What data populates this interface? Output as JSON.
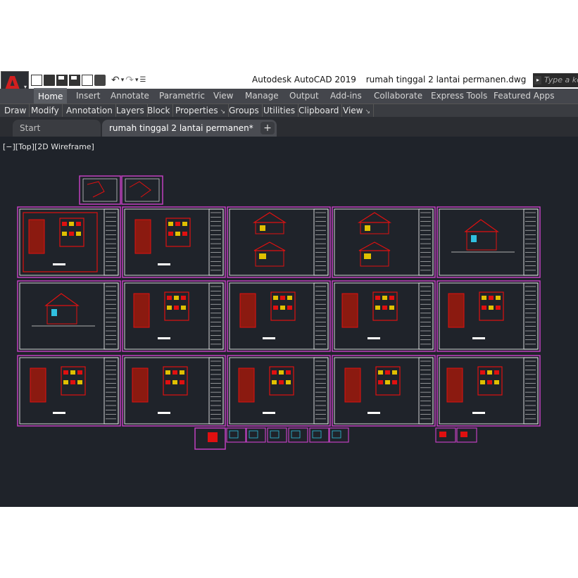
{
  "titlebar": {
    "app_name": "Autodesk AutoCAD 2019",
    "file_name": "rumah tinggal 2 lantai permanen.dwg",
    "search_placeholder": "Type a key",
    "app_icon": "autocad-logo-icon"
  },
  "quick_access": {
    "icons": [
      "new-icon",
      "open-icon",
      "save-icon",
      "save-as-icon",
      "web-mobile-icon",
      "plot-icon",
      "undo-icon",
      "redo-icon",
      "customize-icon"
    ]
  },
  "ribbon_tabs": [
    "Home",
    "Insert",
    "Annotate",
    "Parametric",
    "View",
    "Manage",
    "Output",
    "Add-ins",
    "Collaborate",
    "Express Tools",
    "Featured Apps"
  ],
  "active_ribbon_tab": "Home",
  "panels": [
    "Draw",
    "Modify",
    "Annotation",
    "Layers",
    "Block",
    "Properties",
    "Groups",
    "Utilities",
    "Clipboard",
    "View"
  ],
  "file_tabs": {
    "start": "Start",
    "active": "rumah tinggal 2 lantai permanen*",
    "close_glyph": "✕",
    "add_glyph": "+"
  },
  "viewport": {
    "label": "[−][Top][2D Wireframe]"
  },
  "colors": {
    "canvas": "#1f232a",
    "sheet_border": "#c040c0",
    "drawing_red": "#e01010",
    "ribbon": "#44464c"
  }
}
